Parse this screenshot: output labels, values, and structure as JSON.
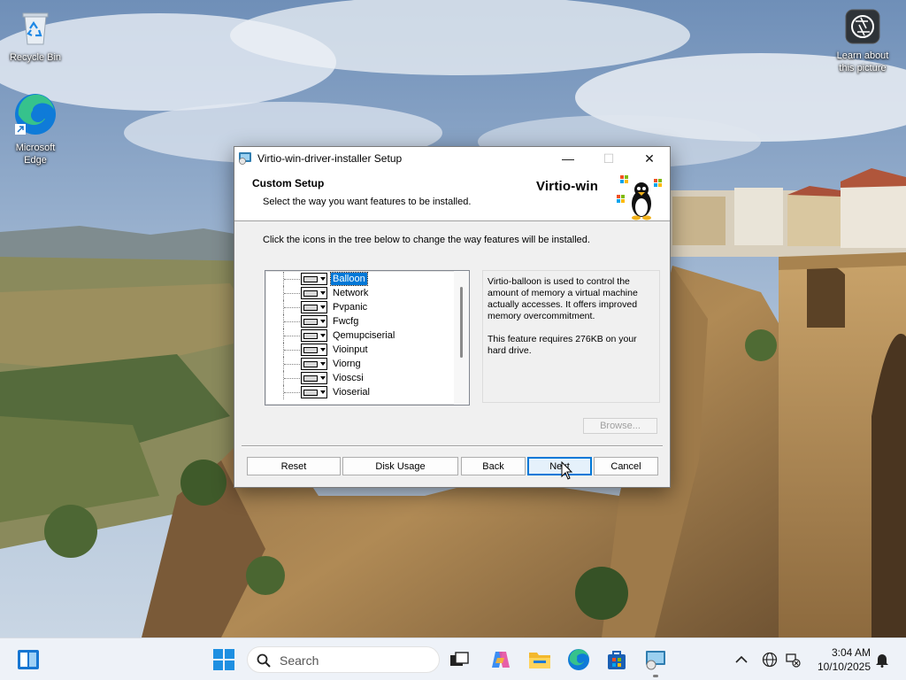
{
  "desktop": {
    "icons": [
      {
        "label": "Recycle Bin",
        "icon": "recycle-bin-icon"
      },
      {
        "label": "Microsoft Edge",
        "icon": "edge-icon"
      },
      {
        "label": "Learn about this picture",
        "icon": "camera-icon"
      }
    ]
  },
  "window": {
    "title": "Virtio-win-driver-installer Setup",
    "controls": {
      "minimize": "—",
      "maximize": "☐",
      "close": "✕"
    },
    "banner": {
      "heading": "Custom Setup",
      "subheading": "Select the way you want features to be installed.",
      "brand": "Virtio-win"
    },
    "instruction": "Click the icons in the tree below to change the way features will be installed.",
    "features": [
      {
        "label": "Balloon",
        "selected": true
      },
      {
        "label": "Network",
        "selected": false
      },
      {
        "label": "Pvpanic",
        "selected": false
      },
      {
        "label": "Fwcfg",
        "selected": false
      },
      {
        "label": "Qemupciserial",
        "selected": false
      },
      {
        "label": "Vioinput",
        "selected": false
      },
      {
        "label": "Viorng",
        "selected": false
      },
      {
        "label": "Vioscsi",
        "selected": false
      },
      {
        "label": "Vioserial",
        "selected": false
      }
    ],
    "description": {
      "text": "Virtio-balloon is used to control the amount of memory a virtual machine actually accesses. It offers improved memory overcommitment.",
      "size_note": "This feature requires 276KB on your hard drive."
    },
    "buttons": {
      "browse": "Browse...",
      "reset": "Reset",
      "disk_usage": "Disk Usage",
      "back": "Back",
      "next": "Next",
      "cancel": "Cancel"
    }
  },
  "taskbar": {
    "search_placeholder": "Search",
    "clock": {
      "time": "3:04 AM",
      "date": "10/10/2025"
    },
    "pinned": [
      "widgets-icon",
      "start-icon",
      "task-view-icon",
      "copilot-icon",
      "file-explorer-icon",
      "edge-icon",
      "store-icon",
      "setup-icon"
    ],
    "tray": [
      "chevron-up-icon",
      "language-icon",
      "network-icon",
      "notification-bell-icon"
    ]
  },
  "colors": {
    "accent": "#0078d7",
    "taskbar": "#eef2f8"
  }
}
